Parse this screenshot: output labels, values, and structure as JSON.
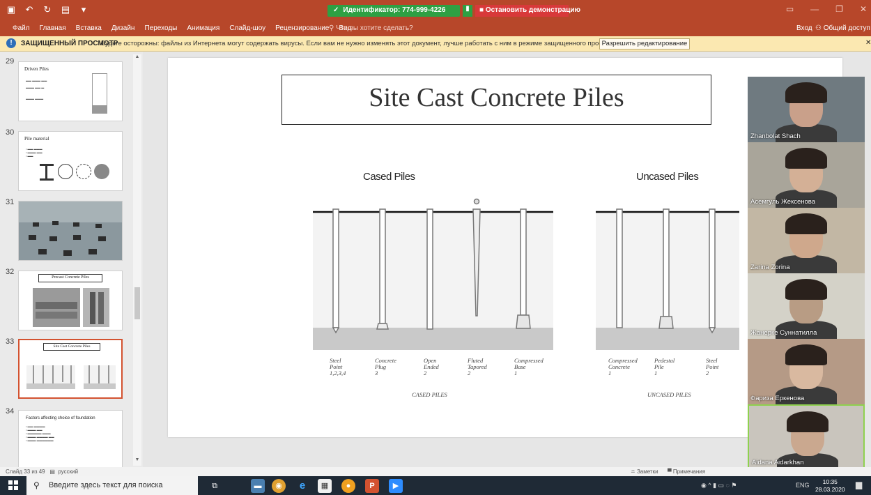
{
  "titlebar": {
    "zoom_id": "Идентификатор: 774-999-4226",
    "stop_share": "Остановить демонстрацию"
  },
  "menu": {
    "items": [
      "Файл",
      "Главная",
      "Вставка",
      "Дизайн",
      "Переходы",
      "Анимация",
      "Слайд-шоу",
      "Рецензирование",
      "Вид"
    ],
    "tell_me": "Что вы хотите сделать?",
    "login": "Вход",
    "share": "Общий доступ"
  },
  "protected_view": {
    "label": "ЗАЩИЩЕННЫЙ ПРОСМОТР",
    "message": "Будьте осторожны: файлы из Интернета могут содержать вирусы. Если вам не нужно изменять этот документ, лучше работать с ним в режиме защищенного просмотра.",
    "button": "Разрешить редактирование"
  },
  "thumbnails": [
    {
      "num": "29",
      "title": "Driven Piles"
    },
    {
      "num": "30",
      "title": "Pile material"
    },
    {
      "num": "31",
      "title": ""
    },
    {
      "num": "32",
      "title": "Precast Concrete Piles"
    },
    {
      "num": "33",
      "title": "Site Cast Concrete Piles"
    },
    {
      "num": "34",
      "title": "Factors affecting choice of foundation"
    }
  ],
  "slide": {
    "title": "Site Cast Concrete Piles",
    "left_heading": "Cased Piles",
    "right_heading": "Uncased Piles",
    "cased_captions": [
      "Steel\nPoint\n1,2,3,4",
      "Concrete\nPlug\n3",
      "Open\nEnded\n2",
      "Fluted\nTapored\n2",
      "Compressed\nBase\n1"
    ],
    "uncased_captions": [
      "Compressed\nConcrete\n1",
      "Pedestal\nPile\n1",
      "Steel\nPoint\n2"
    ],
    "cased_group": "CASED PILES",
    "uncased_group": "UNCASED PILES"
  },
  "participants": [
    {
      "name": "Zhanbolat Shach",
      "bg": "#6f7a80",
      "skin": "#c9a08a"
    },
    {
      "name": "Асемгуль Жексенова",
      "bg": "#a9a59a",
      "skin": "#d4b096"
    },
    {
      "name": "Zarina Zorina",
      "bg": "#c2b7a4",
      "skin": "#cfa88c"
    },
    {
      "name": "Жанерке Суннатилла",
      "bg": "#d4d2c8",
      "skin": "#b89c84"
    },
    {
      "name": "Фариза Еркенова",
      "bg": "#b59a86",
      "skin": "#d9b9a0"
    },
    {
      "name": "Aidana Aidarkhan",
      "bg": "#c9c5bd",
      "skin": "#caa88f"
    }
  ],
  "statusbar": {
    "slide_count": "Слайд 33 из 49",
    "language": "русский",
    "notes": "Заметки",
    "comments": "Примечания"
  },
  "taskbar": {
    "search_placeholder": "Введите здесь текст для поиска",
    "lang": "ENG",
    "time": "10:35",
    "date": "28.03.2020"
  }
}
